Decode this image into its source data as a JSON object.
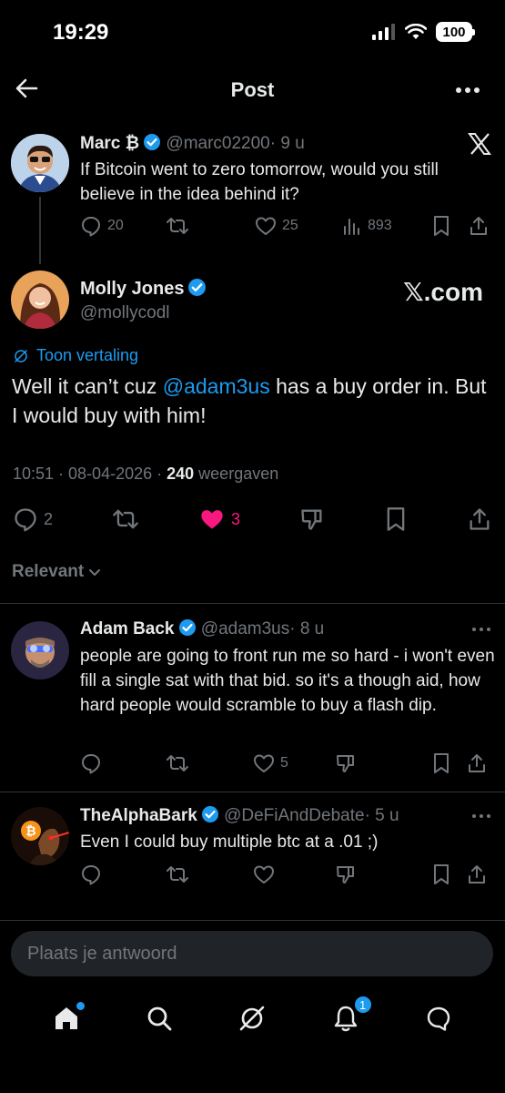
{
  "status_bar": {
    "time": "19:29",
    "battery": "100"
  },
  "header": {
    "title": "Post"
  },
  "parent_post": {
    "name": "Marc ₿",
    "handle": "@marc02200",
    "time": "· 9 u",
    "text": "If Bitcoin went to zero tomorrow, would you still believe in the idea behind it?",
    "replies": "20",
    "likes": "25",
    "views": "893"
  },
  "main_post": {
    "name": "Molly Jones",
    "handle": "@mollycodl",
    "source": "𝕏.com",
    "translate": "Toon vertaling",
    "text_before": "Well it can’t cuz ",
    "mention": "@adam3us",
    "text_after": " has a buy order in. But I would buy with him!",
    "meta_time": "10:51 · 08-04-2026 · ",
    "views_count": "240",
    "views_label": " weergaven",
    "replies": "2",
    "likes": "3",
    "like_color": "#f91880"
  },
  "sort": {
    "label": "Relevant"
  },
  "replies": [
    {
      "name": "Adam Back",
      "handle": "@adam3us",
      "time": "· 8 u",
      "text": "people are going to front run me so hard - i won't even fill a single sat with that bid. so it's a though aid, how hard people would scramble to buy a flash dip.",
      "likes": "5"
    },
    {
      "name": "TheAlphaBark",
      "handle": "@DeFiAndDebate",
      "time": "· 5 u",
      "text": "Even I could buy multiple btc at a .01 ;)",
      "likes": ""
    }
  ],
  "composer": {
    "placeholder": "Plaats je antwoord"
  },
  "bottom_nav": {
    "notifications_badge": "1"
  },
  "colors": {
    "accent": "#1d9bf0",
    "background": "#000000",
    "muted": "#71767b",
    "like": "#f91880"
  }
}
